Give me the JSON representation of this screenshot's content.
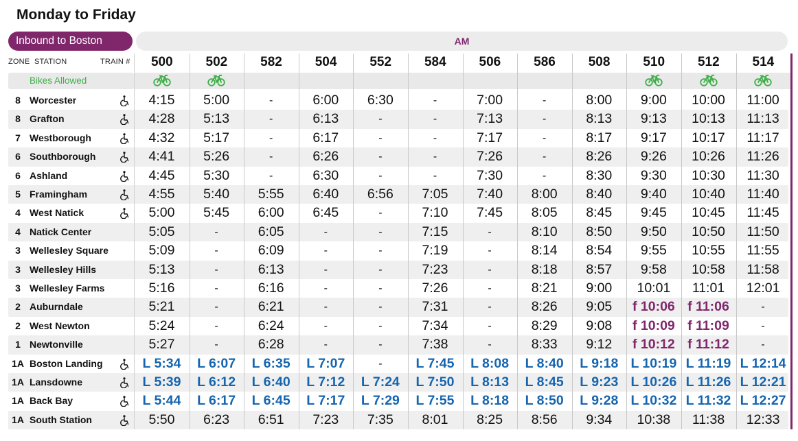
{
  "schedule_title": "Monday to Friday",
  "direction_label": "Inbound to Boston",
  "period_label": "AM",
  "header": {
    "zone_label": "ZONE",
    "station_label": "STATION",
    "train_label": "TRAIN #"
  },
  "bikes_label": "Bikes Allowed",
  "icons": {
    "bike": "bicycle-icon",
    "access": "wheelchair-accessible-icon"
  },
  "colors": {
    "brand": "#80276c",
    "bike_green": "#3fae49",
    "landing_blue": "#1565b0"
  },
  "trains": [
    {
      "number": "500",
      "bikes": true
    },
    {
      "number": "502",
      "bikes": true
    },
    {
      "number": "582",
      "bikes": false
    },
    {
      "number": "504",
      "bikes": false
    },
    {
      "number": "552",
      "bikes": false
    },
    {
      "number": "584",
      "bikes": false
    },
    {
      "number": "506",
      "bikes": false
    },
    {
      "number": "586",
      "bikes": false
    },
    {
      "number": "508",
      "bikes": false
    },
    {
      "number": "510",
      "bikes": true
    },
    {
      "number": "512",
      "bikes": true
    },
    {
      "number": "514",
      "bikes": true
    }
  ],
  "stations": [
    {
      "zone": "8",
      "name": "Worcester",
      "accessible": true,
      "times": [
        "4:15",
        "5:00",
        "-",
        "6:00",
        "6:30",
        "-",
        "7:00",
        "-",
        "8:00",
        "9:00",
        "10:00",
        "11:00"
      ]
    },
    {
      "zone": "8",
      "name": "Grafton",
      "accessible": true,
      "times": [
        "4:28",
        "5:13",
        "-",
        "6:13",
        "-",
        "-",
        "7:13",
        "-",
        "8:13",
        "9:13",
        "10:13",
        "11:13"
      ]
    },
    {
      "zone": "7",
      "name": "Westborough",
      "accessible": true,
      "times": [
        "4:32",
        "5:17",
        "-",
        "6:17",
        "-",
        "-",
        "7:17",
        "-",
        "8:17",
        "9:17",
        "10:17",
        "11:17"
      ]
    },
    {
      "zone": "6",
      "name": "Southborough",
      "accessible": true,
      "times": [
        "4:41",
        "5:26",
        "-",
        "6:26",
        "-",
        "-",
        "7:26",
        "-",
        "8:26",
        "9:26",
        "10:26",
        "11:26"
      ]
    },
    {
      "zone": "6",
      "name": "Ashland",
      "accessible": true,
      "times": [
        "4:45",
        "5:30",
        "-",
        "6:30",
        "-",
        "-",
        "7:30",
        "-",
        "8:30",
        "9:30",
        "10:30",
        "11:30"
      ]
    },
    {
      "zone": "5",
      "name": "Framingham",
      "accessible": true,
      "times": [
        "4:55",
        "5:40",
        "5:55",
        "6:40",
        "6:56",
        "7:05",
        "7:40",
        "8:00",
        "8:40",
        "9:40",
        "10:40",
        "11:40"
      ]
    },
    {
      "zone": "4",
      "name": "West Natick",
      "accessible": true,
      "times": [
        "5:00",
        "5:45",
        "6:00",
        "6:45",
        "-",
        "7:10",
        "7:45",
        "8:05",
        "8:45",
        "9:45",
        "10:45",
        "11:45"
      ]
    },
    {
      "zone": "4",
      "name": "Natick Center",
      "accessible": false,
      "times": [
        "5:05",
        "-",
        "6:05",
        "-",
        "-",
        "7:15",
        "-",
        "8:10",
        "8:50",
        "9:50",
        "10:50",
        "11:50"
      ]
    },
    {
      "zone": "3",
      "name": "Wellesley Square",
      "accessible": false,
      "times": [
        "5:09",
        "-",
        "6:09",
        "-",
        "-",
        "7:19",
        "-",
        "8:14",
        "8:54",
        "9:55",
        "10:55",
        "11:55"
      ]
    },
    {
      "zone": "3",
      "name": "Wellesley Hills",
      "accessible": false,
      "times": [
        "5:13",
        "-",
        "6:13",
        "-",
        "-",
        "7:23",
        "-",
        "8:18",
        "8:57",
        "9:58",
        "10:58",
        "11:58"
      ]
    },
    {
      "zone": "3",
      "name": "Wellesley Farms",
      "accessible": false,
      "times": [
        "5:16",
        "-",
        "6:16",
        "-",
        "-",
        "7:26",
        "-",
        "8:21",
        "9:00",
        "10:01",
        "11:01",
        "12:01"
      ]
    },
    {
      "zone": "2",
      "name": "Auburndale",
      "accessible": false,
      "times": [
        "5:21",
        "-",
        "6:21",
        "-",
        "-",
        "7:31",
        "-",
        "8:26",
        "9:05",
        "f 10:06",
        "f 11:06",
        "-"
      ]
    },
    {
      "zone": "2",
      "name": "West Newton",
      "accessible": false,
      "times": [
        "5:24",
        "-",
        "6:24",
        "-",
        "-",
        "7:34",
        "-",
        "8:29",
        "9:08",
        "f 10:09",
        "f 11:09",
        "-"
      ]
    },
    {
      "zone": "1",
      "name": "Newtonville",
      "accessible": false,
      "times": [
        "5:27",
        "-",
        "6:28",
        "-",
        "-",
        "7:38",
        "-",
        "8:33",
        "9:12",
        "f 10:12",
        "f 11:12",
        "-"
      ]
    },
    {
      "zone": "1A",
      "name": "Boston Landing",
      "accessible": true,
      "times": [
        "L 5:34",
        "L 6:07",
        "L 6:35",
        "L 7:07",
        "-",
        "L 7:45",
        "L 8:08",
        "L 8:40",
        "L 9:18",
        "L 10:19",
        "L 11:19",
        "L 12:14"
      ]
    },
    {
      "zone": "1A",
      "name": "Lansdowne",
      "accessible": true,
      "times": [
        "L 5:39",
        "L 6:12",
        "L 6:40",
        "L 7:12",
        "L 7:24",
        "L 7:50",
        "L 8:13",
        "L 8:45",
        "L 9:23",
        "L 10:26",
        "L 11:26",
        "L 12:21"
      ]
    },
    {
      "zone": "1A",
      "name": "Back Bay",
      "accessible": true,
      "times": [
        "L 5:44",
        "L 6:17",
        "L 6:45",
        "L 7:17",
        "L 7:29",
        "L 7:55",
        "L 8:18",
        "L 8:50",
        "L 9:28",
        "L 10:32",
        "L 11:32",
        "L 12:27"
      ]
    },
    {
      "zone": "1A",
      "name": "South Station",
      "accessible": true,
      "times": [
        "5:50",
        "6:23",
        "6:51",
        "7:23",
        "7:35",
        "8:01",
        "8:25",
        "8:56",
        "9:34",
        "10:38",
        "11:38",
        "12:33"
      ]
    }
  ]
}
